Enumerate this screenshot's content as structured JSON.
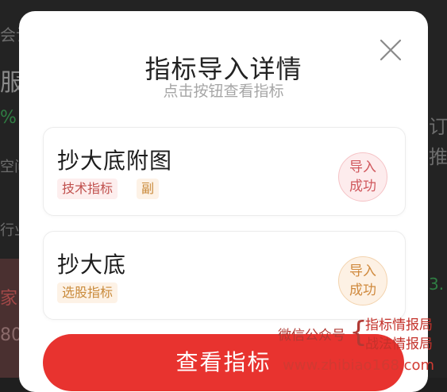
{
  "background": {
    "fragments": [
      "会计",
      "服",
      "%",
      "空间",
      "行业",
      "家",
      "80",
      "订",
      "推",
      "3."
    ]
  },
  "modal": {
    "title": "指标导入详情",
    "subtitle": "点击按钮查看指标",
    "close_icon": "close-icon",
    "items": [
      {
        "title": "抄大底附图",
        "tags": [
          "技术指标",
          "副"
        ],
        "status_line1": "导入",
        "status_line2": "成功",
        "status_color": "#d0585d"
      },
      {
        "title": "抄大底",
        "tags": [
          "选股指标"
        ],
        "status_line1": "导入",
        "status_line2": "成功",
        "status_color": "#d08a3e"
      }
    ],
    "view_button_label": "查看指标"
  },
  "watermark": {
    "account_label": "微信公众号",
    "bracket": "{",
    "name_line1": "指标情报局",
    "name_line2": "战法情报局",
    "url": "www.zhibiao168.com"
  },
  "colors": {
    "accent": "#e8332f",
    "title_text": "#222222",
    "subtitle_text": "#a6a6a6"
  }
}
